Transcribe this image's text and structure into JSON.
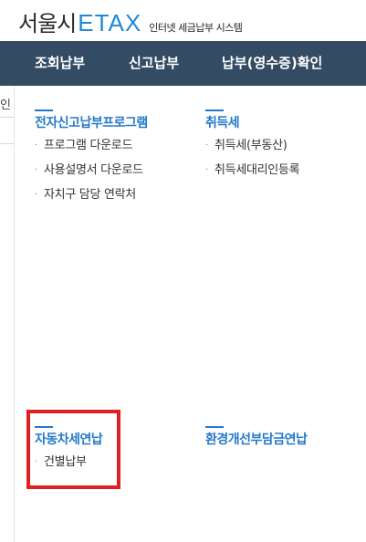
{
  "header": {
    "logo_city": "서울시",
    "logo_brand": "ETAX",
    "logo_sub": "인터넷 세금납부 시스템"
  },
  "nav": {
    "items": [
      {
        "label": "조회납부"
      },
      {
        "label": "신고납부"
      },
      {
        "label": "납부(영수증)확인"
      }
    ]
  },
  "sidebar_fragment": {
    "char": "인"
  },
  "sections": [
    {
      "title": "전자신고납부프로그램",
      "items": [
        "프로그램 다운로드",
        "사용설명서 다운로드",
        "자치구 담당 연락처"
      ]
    },
    {
      "title": "취득세",
      "items": [
        "취득세(부동산)",
        "취득세대리인등록"
      ]
    },
    {
      "title": "자동차세연납",
      "items": [
        "건별납부"
      ]
    },
    {
      "title": "환경개선부담금연납",
      "items": []
    }
  ],
  "colors": {
    "nav_bg": "#334b63",
    "accent": "#2579c9",
    "brand": "#1f8ad8",
    "highlight": "#e02020"
  }
}
